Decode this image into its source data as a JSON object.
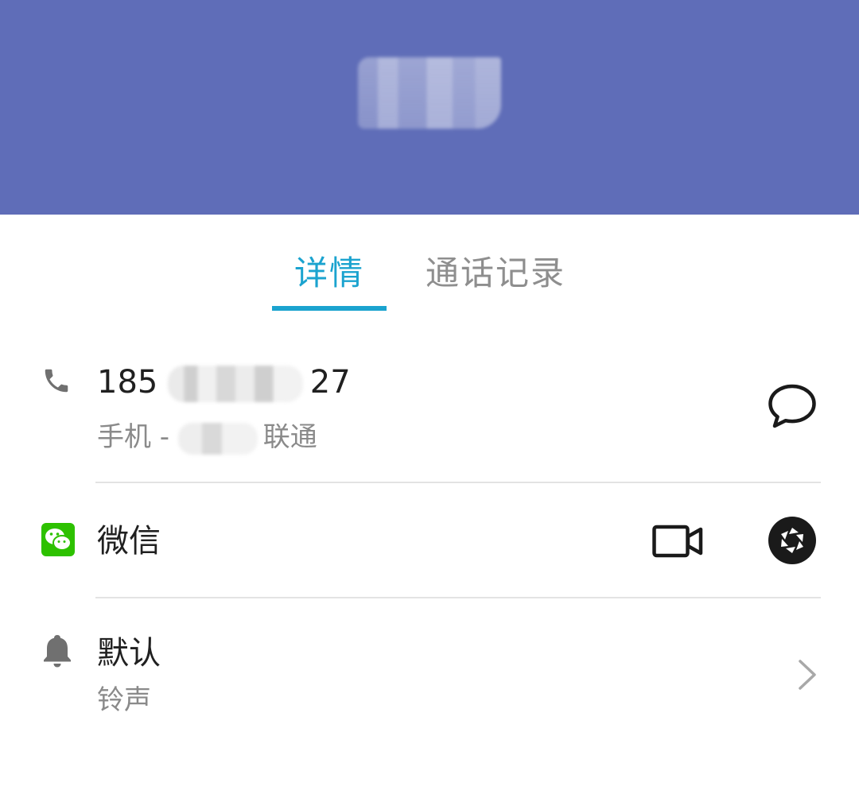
{
  "header": {
    "contact_name_obscured": ""
  },
  "tabs": [
    {
      "label": "详情",
      "active": true
    },
    {
      "label": "通话记录",
      "active": false
    }
  ],
  "phone": {
    "number_prefix": "185",
    "number_suffix": "27",
    "type_prefix": "手机 - ",
    "carrier": "联通",
    "icon": "phone-icon",
    "action_icon": "message-bubble-icon"
  },
  "wechat": {
    "label": "微信",
    "icon": "wechat-icon",
    "actions": [
      "video-call-icon",
      "moments-shutter-icon"
    ]
  },
  "ringtone": {
    "value": "默认",
    "label": "铃声",
    "icon": "bell-icon",
    "action_icon": "chevron-right-icon"
  },
  "colors": {
    "header_bg": "#5f6db8",
    "accent": "#1ba3cf",
    "wechat_green": "#2dc100"
  }
}
